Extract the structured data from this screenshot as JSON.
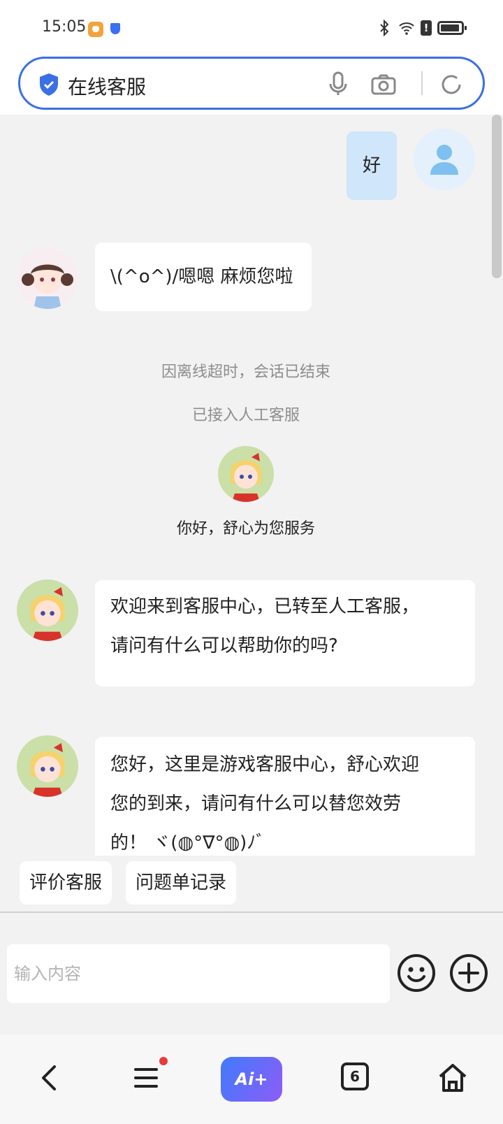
{
  "status": {
    "time": "15:05"
  },
  "header": {
    "title": "在线客服"
  },
  "chat": {
    "user_msg": "好",
    "agent_msg1": "\\(^o^)/嗯嗯 麻烦您啦",
    "sys1": "因离线超时，会话已结束",
    "sys2": "已接入人工客服",
    "greeting": "你好，舒心为您服务",
    "msg2_line1": "欢迎来到客服中心，已转至人工客服，",
    "msg2_line2": "请问有什么可以帮助你的吗?",
    "msg3_line1": "您好，这里是游戏客服中心，舒心欢迎",
    "msg3_line2": "您的到来，请问有什么可以替您效劳",
    "msg3_line3": "的！ ヾ(◍°∇°◍)ﾉﾞ"
  },
  "quick": {
    "rate": "评价客服",
    "records": "问题单记录"
  },
  "input": {
    "placeholder": "输入内容"
  },
  "nav": {
    "ai_label": "Ai+",
    "tab_count": "6"
  },
  "colors": {
    "accent": "#3a6fe6",
    "user_bubble": "#cfe6fb",
    "bg": "#f2f2f2"
  },
  "icons": [
    "verified-shield-icon",
    "mic-icon",
    "camera-icon",
    "refresh-icon",
    "emoji-icon",
    "plus-icon",
    "back-icon",
    "menu-icon",
    "home-icon",
    "bluetooth-icon",
    "wifi-icon",
    "battery-icon"
  ]
}
